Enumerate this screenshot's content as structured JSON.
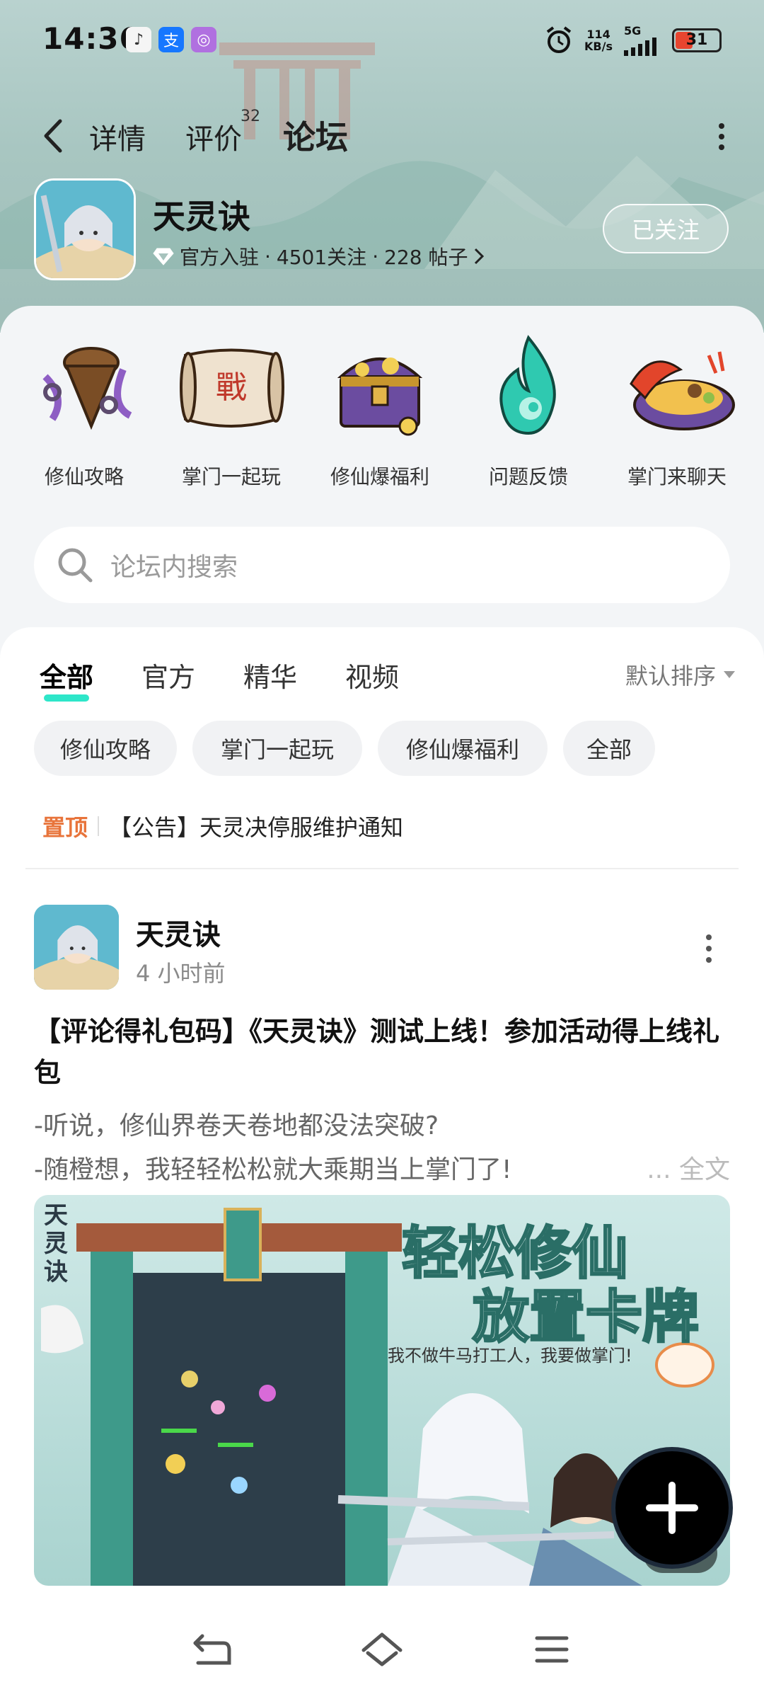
{
  "status_bar": {
    "time": "14:36",
    "app_icons": [
      "music-icon",
      "alipay-icon",
      "app-icon"
    ],
    "net_speed_value": "114",
    "net_speed_unit": "KB/s",
    "network": "5G",
    "battery": "31"
  },
  "nav": {
    "tabs": [
      {
        "label": "详情",
        "active": false
      },
      {
        "label": "评价",
        "active": false
      },
      {
        "label": "论坛",
        "active": true
      }
    ],
    "review_badge": "32"
  },
  "game": {
    "title": "天灵诀",
    "meta_official": "官方入驻",
    "meta_followers": "4501关注",
    "meta_posts": "228 帖子",
    "meta_dot": "·",
    "follow_button": "已关注"
  },
  "categories": [
    {
      "label": "修仙攻略",
      "icon": "scroll-chain-icon"
    },
    {
      "label": "掌门一起玩",
      "icon": "battle-scroll-icon"
    },
    {
      "label": "修仙爆福利",
      "icon": "treasure-chest-icon"
    },
    {
      "label": "问题反馈",
      "icon": "spirit-flame-icon"
    },
    {
      "label": "掌门来聊天",
      "icon": "food-plate-icon"
    }
  ],
  "search": {
    "placeholder": "论坛内搜索"
  },
  "filter_tabs": [
    {
      "label": "全部",
      "active": true
    },
    {
      "label": "官方",
      "active": false
    },
    {
      "label": "精华",
      "active": false
    },
    {
      "label": "视频",
      "active": false
    }
  ],
  "sort_label": "默认排序",
  "chips": [
    "修仙攻略",
    "掌门一起玩",
    "修仙爆福利",
    "全部"
  ],
  "pinned": {
    "tag": "置顶",
    "text": "【公告】天灵决停服维护通知"
  },
  "post": {
    "author": "天灵诀",
    "time": "4 小时前",
    "title": "【评论得礼包码】《天灵诀》测试上线！参加活动得上线礼包",
    "line1": "-听说，修仙界卷天卷地都没法突破?",
    "line2": "-随橙想，我轻轻松松就大乘期当上掌门了!",
    "full_text": "... 全文",
    "image": {
      "corner_text": "天灵诀",
      "headline1": "轻松修仙",
      "headline2": "放置卡牌",
      "tagline": "我不做牛马打工人，我要做掌门!",
      "count": "2"
    }
  },
  "colors": {
    "accent": "#2ee6c9",
    "pin_tag": "#e8743b"
  }
}
